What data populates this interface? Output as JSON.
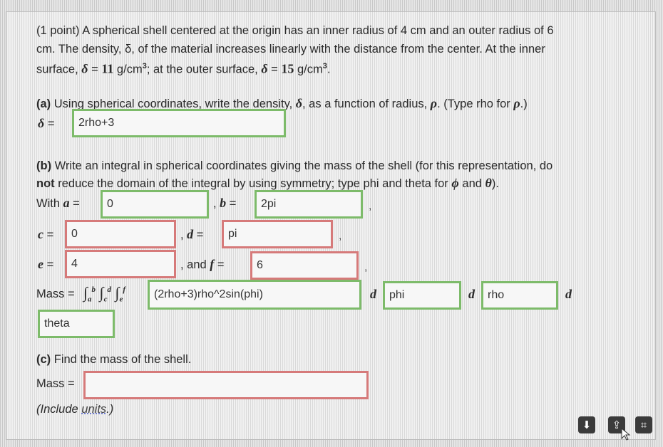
{
  "problem": {
    "line1": "(1 point) A spherical shell centered at the origin has an inner radius of 4 cm and an outer radius of 6",
    "line2": "cm. The density, δ, of the material increases linearly with the distance from the center. At the inner",
    "line3_a": "surface, ",
    "delta_sym": "δ",
    "eq": " = ",
    "inner_val": "11",
    "unit_gcm": " g/cm",
    "cube": "3",
    "line3_b": "; at the outer surface, ",
    "outer_val": "15",
    "period": "."
  },
  "part_a": {
    "label": "(a)",
    "text_1": " Using spherical coordinates, write the density, ",
    "text_2": ", as a function of radius, ",
    "rho_sym": "ρ",
    "text_3": ". (Type rho for ",
    "text_4": ".)",
    "delta_lhs": "δ",
    "eq": " =",
    "answer": "2rho+3"
  },
  "part_b": {
    "label": "(b)",
    "line1": " Write an integral in spherical coordinates giving the mass of the shell (for this representation, do",
    "bold_not": "not",
    "line2_a": " reduce the domain of the integral by using symmetry; type phi and theta for ",
    "phi_sym": "ϕ",
    "and": " and ",
    "theta_sym": "θ",
    "line2_b": ").",
    "with": "With ",
    "a": "a",
    "b": "b",
    "c": "c",
    "d": "d",
    "e": "e",
    "f": "f",
    "eq": " = ",
    "comma": ", ",
    "and_text": ", and ",
    "a_val": "0",
    "b_val": "2pi",
    "c_val": "0",
    "d_val": "pi",
    "e_val": "4",
    "f_val": "6",
    "mass_label": "Mass = ",
    "integrand": "(2rho+3)rho^2sin(phi)",
    "d_letter": "d",
    "var1": "phi",
    "var2": "rho",
    "var3": "theta"
  },
  "part_c": {
    "label": "(c)",
    "text": " Find the mass of the shell.",
    "mass_label": "Mass = ",
    "mass_value": "",
    "include_a": "(Include ",
    "units_link": "units",
    "include_b": ".)"
  },
  "toolbar": {
    "download": "⬇",
    "upload": "⇪",
    "grid": "⌗"
  }
}
